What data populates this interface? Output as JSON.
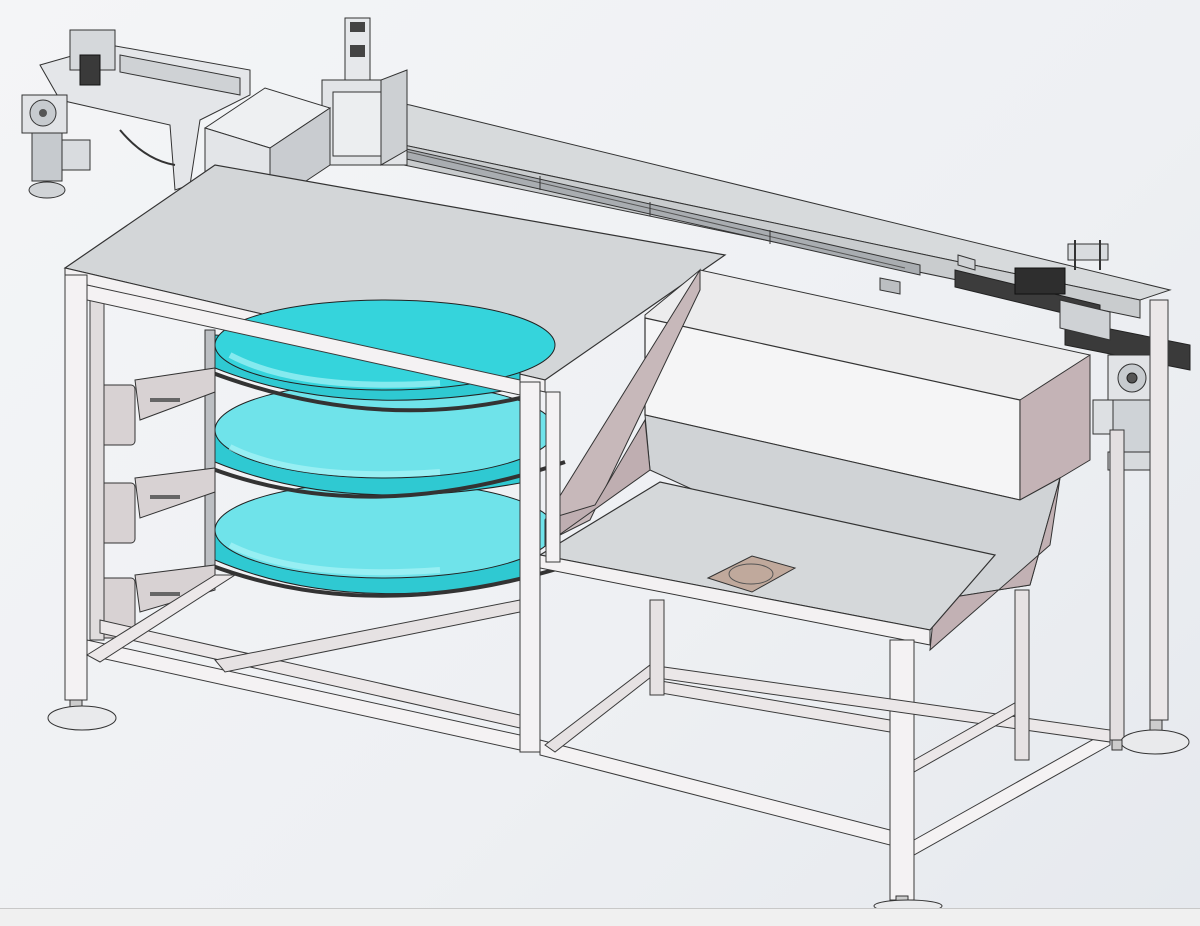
{
  "scene": {
    "description_free": true,
    "colors": {
      "background": "#eef0f3",
      "frame": "#f4f2f3",
      "frame_edge": "#3a3a3a",
      "panel": "#d7dadc",
      "panel_shadow": "#b9a9ac",
      "hopper_side": "#c7b8ba",
      "carousel": "#35d4dc",
      "carousel_dark": "#1aa6b0",
      "carousel_light": "#7ee9ef",
      "metal": "#e6e6ea",
      "dark_metal": "#4a4a4a"
    },
    "carousel_tiers": 3,
    "arm_brackets": 3,
    "feet": 4
  },
  "status_bar": {
    "text": ""
  }
}
